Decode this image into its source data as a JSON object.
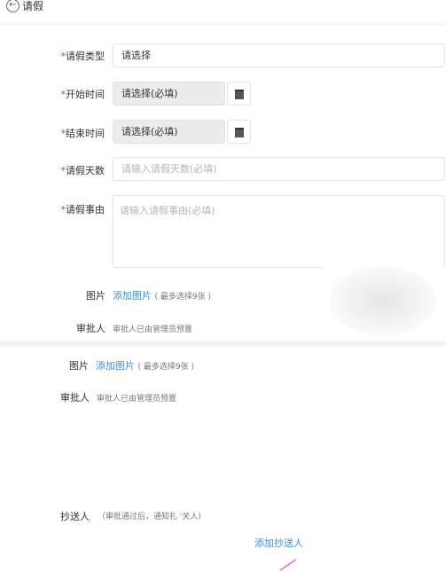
{
  "header": {
    "back_icon": "←",
    "title": "请假"
  },
  "form": {
    "leave_type": {
      "required_mark": "*",
      "label": "请假类型",
      "value": "请选择"
    },
    "start_time": {
      "required_mark": "*",
      "label": "开始时间",
      "value": "请选择(必填)"
    },
    "end_time": {
      "required_mark": "*",
      "label": "结束时间",
      "value": "请选择(必填)"
    },
    "days": {
      "required_mark": "*",
      "label": "请假天数",
      "placeholder": "请输入请假天数(必填)"
    },
    "reason": {
      "required_mark": "*",
      "label": "请假事由",
      "placeholder": "请输入请假事由(必填)"
    },
    "image": {
      "label": "图片",
      "link": "添加图片",
      "hint": "( 最多选择9张 )"
    },
    "approver": {
      "label": "审批人",
      "text": "审批人已由管理员预置"
    }
  },
  "lower": {
    "image": {
      "label": "图片",
      "link": "添加图片",
      "hint": "( 最多选择9张 )"
    },
    "approver": {
      "label": "审批人",
      "text": "审批人已由管理员预置"
    },
    "cc": {
      "label": "抄送人",
      "hint": "（审批通过后，通知扎 '关人)",
      "add_link": "添加抄送人"
    }
  },
  "colors": {
    "required": "#e33333",
    "link": "#3a8ee6",
    "border": "#dfe3e8"
  },
  "icons": {
    "back": "back-circle-icon",
    "calendar": "calendar-icon"
  }
}
